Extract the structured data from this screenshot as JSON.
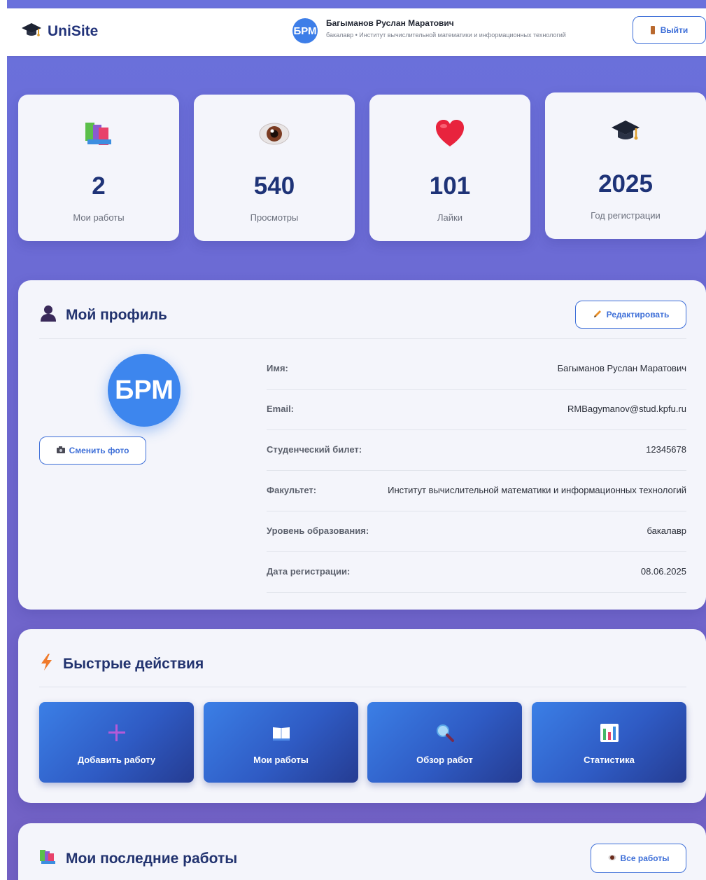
{
  "header": {
    "logo_text": "UniSite",
    "avatar_initials": "БРМ",
    "user_name": "Багыманов Руслан Маратович",
    "user_subtitle": "бакалавр • Институт вычислительной математики и информационных технологий",
    "logout_label": "Выйти"
  },
  "stats": [
    {
      "icon": "books-icon",
      "value": "2",
      "label": "Мои работы"
    },
    {
      "icon": "eye-icon",
      "value": "540",
      "label": "Просмотры"
    },
    {
      "icon": "heart-icon",
      "value": "101",
      "label": "Лайки"
    },
    {
      "icon": "graduation-cap-icon",
      "value": "2025",
      "label": "Год регистрации"
    }
  ],
  "profile": {
    "title": "Мой профиль",
    "edit_label": "Редактировать",
    "avatar_initials": "БРМ",
    "change_photo_label": "Сменить фото",
    "fields": [
      {
        "key": "Имя:",
        "value": "Багыманов Руслан Маратович"
      },
      {
        "key": "Email:",
        "value": "RMBagymanov@stud.kpfu.ru"
      },
      {
        "key": "Студенческий билет:",
        "value": "12345678"
      },
      {
        "key": "Факультет:",
        "value": "Институт вычислительной математики и информационных технологий"
      },
      {
        "key": "Уровень образования:",
        "value": "бакалавр"
      },
      {
        "key": "Дата регистрации:",
        "value": "08.06.2025"
      }
    ]
  },
  "quick_actions": {
    "title": "Быстрые действия",
    "items": [
      {
        "icon": "plus-icon",
        "label": "Добавить работу"
      },
      {
        "icon": "book-icon",
        "label": "Мои работы"
      },
      {
        "icon": "magnifier-icon",
        "label": "Обзор работ"
      },
      {
        "icon": "bar-chart-icon",
        "label": "Статистика"
      }
    ]
  },
  "recent_works": {
    "title": "Мои последние работы",
    "all_label": "Все работы"
  },
  "colors": {
    "accent": "#3e6fd8",
    "title": "#22336f",
    "gradient_top": "#6a71dc",
    "gradient_bottom": "#7361c4"
  }
}
